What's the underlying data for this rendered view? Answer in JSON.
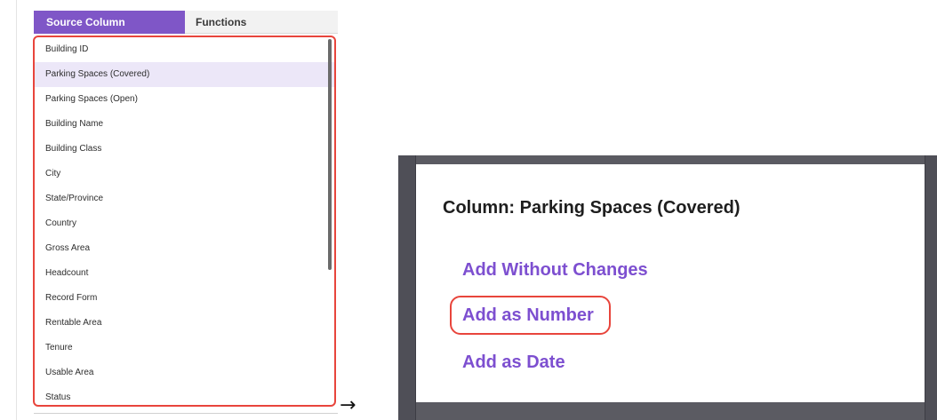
{
  "tabs": {
    "source_column": "Source Column",
    "functions": "Functions"
  },
  "columns": [
    {
      "label": "Building ID",
      "selected": false
    },
    {
      "label": "Parking Spaces (Covered)",
      "selected": true
    },
    {
      "label": "Parking Spaces (Open)",
      "selected": false
    },
    {
      "label": "Building Name",
      "selected": false
    },
    {
      "label": "Building Class",
      "selected": false
    },
    {
      "label": "City",
      "selected": false
    },
    {
      "label": "State/Province",
      "selected": false
    },
    {
      "label": "Country",
      "selected": false
    },
    {
      "label": "Gross Area",
      "selected": false
    },
    {
      "label": "Headcount",
      "selected": false
    },
    {
      "label": "Record Form",
      "selected": false
    },
    {
      "label": "Rentable Area",
      "selected": false
    },
    {
      "label": "Tenure",
      "selected": false
    },
    {
      "label": "Usable Area",
      "selected": false
    },
    {
      "label": "Status",
      "selected": false
    }
  ],
  "arrow": "→",
  "dialog": {
    "title": "Column: Parking Spaces (Covered)",
    "options": [
      "Add Without Changes",
      "Add as Number",
      "Add as Date"
    ]
  },
  "colors": {
    "accent": "#7f56c7",
    "option_text": "#7d4fd0",
    "highlight_border": "#e8453c",
    "selected_row": "#ece7f8"
  }
}
